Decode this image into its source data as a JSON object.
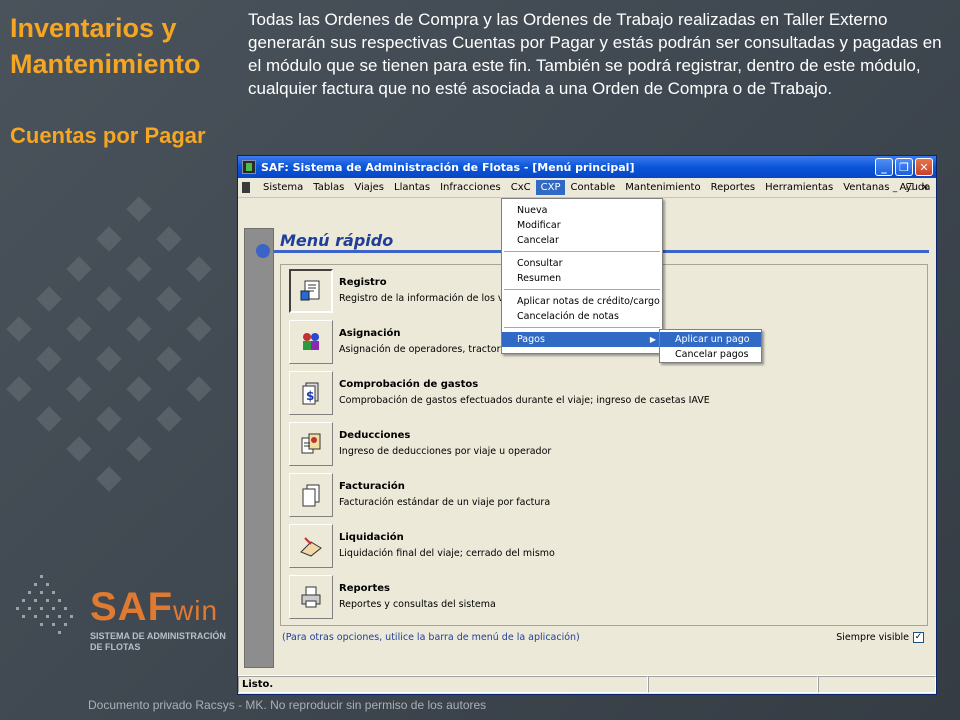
{
  "slide": {
    "title": "Inventarios y Mantenimiento",
    "subtitle": "Cuentas por Pagar",
    "intro": "Todas las Ordenes de Compra y las Ordenes de Trabajo realizadas en Taller Externo generarán sus respectivas Cuentas por Pagar y estás podrán ser consultadas y pagadas en el módulo que se tienen para este fin. También se podrá registrar, dentro de este módulo, cualquier factura que no esté asociada a una Orden de Compra o de Trabajo.",
    "logo_main": "SAF",
    "logo_suffix": "win",
    "logo_subtitle": "SISTEMA DE ADMINISTRACIÓN DE FLOTAS",
    "footer": "Documento privado Racsys - MK. No reproducir sin permiso de los autores",
    "accent_color": "#f5a623"
  },
  "window": {
    "title": "SAF: Sistema de Administración de Flotas - [Menú principal]",
    "buttons": {
      "minimize": "_",
      "maximize": "❐",
      "close": "✕"
    }
  },
  "menubar": {
    "items": [
      "Sistema",
      "Tablas",
      "Viajes",
      "Llantas",
      "Infracciones",
      "CxC",
      "CXP",
      "Contable",
      "Mantenimiento",
      "Reportes",
      "Herramientas",
      "Ventanas",
      "Ayuda"
    ],
    "active": "CXP",
    "mdi_buttons": [
      "_",
      "❐",
      "✕"
    ]
  },
  "cxp_menu": {
    "group1": [
      "Nueva",
      "Modificar",
      "Cancelar"
    ],
    "group2": [
      "Consultar",
      "Resumen"
    ],
    "group3": [
      "Aplicar notas de crédito/cargo",
      "Cancelación de notas"
    ],
    "pagos": "Pagos",
    "pagos_arrow": "▶",
    "submenu": [
      "Aplicar un pago",
      "Cancelar pagos"
    ]
  },
  "panel": {
    "title": "Menú rápido",
    "rows": [
      {
        "title": "Registro",
        "desc": "Registro de la información de los viajes;",
        "icon": "registro-icon"
      },
      {
        "title": "Asignación",
        "desc": "Asignación de operadores, tractor, remolques y dolly; anticipos de gastos y casetas",
        "icon": "asignacion-icon"
      },
      {
        "title": "Comprobación de gastos",
        "desc": "Comprobación de gastos efectuados durante el viaje; ingreso de casetas IAVE",
        "icon": "comprobacion-icon"
      },
      {
        "title": "Deducciones",
        "desc": "Ingreso de deducciones por viaje u operador",
        "icon": "deducciones-icon"
      },
      {
        "title": "Facturación",
        "desc": "Facturación estándar de un viaje por factura",
        "icon": "facturacion-icon"
      },
      {
        "title": "Liquidación",
        "desc": "Liquidación final del viaje; cerrado del mismo",
        "icon": "liquidacion-icon"
      },
      {
        "title": "Reportes",
        "desc": "Reportes y consultas del sistema",
        "icon": "printer-icon"
      }
    ],
    "hint": "(Para otras opciones, utilice la barra de menú de la aplicación)",
    "siempre_visible": "Siempre visible",
    "siempre_checked": "✓"
  },
  "statusbar": {
    "text": "Listo."
  }
}
